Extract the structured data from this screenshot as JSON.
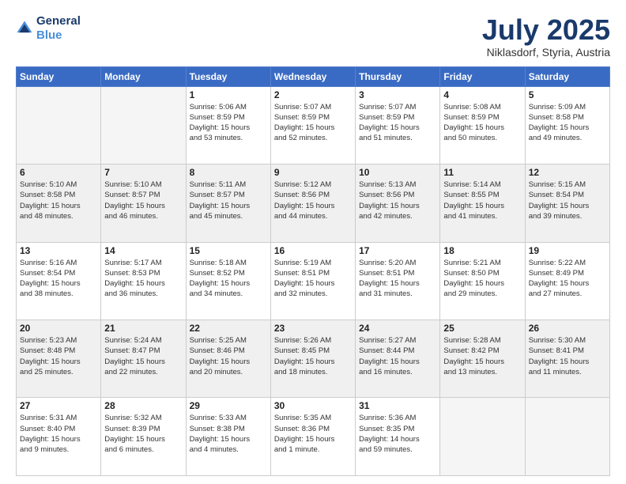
{
  "header": {
    "logo_line1": "General",
    "logo_line2": "Blue",
    "month": "July 2025",
    "location": "Niklasdorf, Styria, Austria"
  },
  "weekdays": [
    "Sunday",
    "Monday",
    "Tuesday",
    "Wednesday",
    "Thursday",
    "Friday",
    "Saturday"
  ],
  "weeks": [
    {
      "shaded": false,
      "days": [
        {
          "num": "",
          "lines": []
        },
        {
          "num": "",
          "lines": []
        },
        {
          "num": "1",
          "lines": [
            "Sunrise: 5:06 AM",
            "Sunset: 8:59 PM",
            "Daylight: 15 hours",
            "and 53 minutes."
          ]
        },
        {
          "num": "2",
          "lines": [
            "Sunrise: 5:07 AM",
            "Sunset: 8:59 PM",
            "Daylight: 15 hours",
            "and 52 minutes."
          ]
        },
        {
          "num": "3",
          "lines": [
            "Sunrise: 5:07 AM",
            "Sunset: 8:59 PM",
            "Daylight: 15 hours",
            "and 51 minutes."
          ]
        },
        {
          "num": "4",
          "lines": [
            "Sunrise: 5:08 AM",
            "Sunset: 8:59 PM",
            "Daylight: 15 hours",
            "and 50 minutes."
          ]
        },
        {
          "num": "5",
          "lines": [
            "Sunrise: 5:09 AM",
            "Sunset: 8:58 PM",
            "Daylight: 15 hours",
            "and 49 minutes."
          ]
        }
      ]
    },
    {
      "shaded": true,
      "days": [
        {
          "num": "6",
          "lines": [
            "Sunrise: 5:10 AM",
            "Sunset: 8:58 PM",
            "Daylight: 15 hours",
            "and 48 minutes."
          ]
        },
        {
          "num": "7",
          "lines": [
            "Sunrise: 5:10 AM",
            "Sunset: 8:57 PM",
            "Daylight: 15 hours",
            "and 46 minutes."
          ]
        },
        {
          "num": "8",
          "lines": [
            "Sunrise: 5:11 AM",
            "Sunset: 8:57 PM",
            "Daylight: 15 hours",
            "and 45 minutes."
          ]
        },
        {
          "num": "9",
          "lines": [
            "Sunrise: 5:12 AM",
            "Sunset: 8:56 PM",
            "Daylight: 15 hours",
            "and 44 minutes."
          ]
        },
        {
          "num": "10",
          "lines": [
            "Sunrise: 5:13 AM",
            "Sunset: 8:56 PM",
            "Daylight: 15 hours",
            "and 42 minutes."
          ]
        },
        {
          "num": "11",
          "lines": [
            "Sunrise: 5:14 AM",
            "Sunset: 8:55 PM",
            "Daylight: 15 hours",
            "and 41 minutes."
          ]
        },
        {
          "num": "12",
          "lines": [
            "Sunrise: 5:15 AM",
            "Sunset: 8:54 PM",
            "Daylight: 15 hours",
            "and 39 minutes."
          ]
        }
      ]
    },
    {
      "shaded": false,
      "days": [
        {
          "num": "13",
          "lines": [
            "Sunrise: 5:16 AM",
            "Sunset: 8:54 PM",
            "Daylight: 15 hours",
            "and 38 minutes."
          ]
        },
        {
          "num": "14",
          "lines": [
            "Sunrise: 5:17 AM",
            "Sunset: 8:53 PM",
            "Daylight: 15 hours",
            "and 36 minutes."
          ]
        },
        {
          "num": "15",
          "lines": [
            "Sunrise: 5:18 AM",
            "Sunset: 8:52 PM",
            "Daylight: 15 hours",
            "and 34 minutes."
          ]
        },
        {
          "num": "16",
          "lines": [
            "Sunrise: 5:19 AM",
            "Sunset: 8:51 PM",
            "Daylight: 15 hours",
            "and 32 minutes."
          ]
        },
        {
          "num": "17",
          "lines": [
            "Sunrise: 5:20 AM",
            "Sunset: 8:51 PM",
            "Daylight: 15 hours",
            "and 31 minutes."
          ]
        },
        {
          "num": "18",
          "lines": [
            "Sunrise: 5:21 AM",
            "Sunset: 8:50 PM",
            "Daylight: 15 hours",
            "and 29 minutes."
          ]
        },
        {
          "num": "19",
          "lines": [
            "Sunrise: 5:22 AM",
            "Sunset: 8:49 PM",
            "Daylight: 15 hours",
            "and 27 minutes."
          ]
        }
      ]
    },
    {
      "shaded": true,
      "days": [
        {
          "num": "20",
          "lines": [
            "Sunrise: 5:23 AM",
            "Sunset: 8:48 PM",
            "Daylight: 15 hours",
            "and 25 minutes."
          ]
        },
        {
          "num": "21",
          "lines": [
            "Sunrise: 5:24 AM",
            "Sunset: 8:47 PM",
            "Daylight: 15 hours",
            "and 22 minutes."
          ]
        },
        {
          "num": "22",
          "lines": [
            "Sunrise: 5:25 AM",
            "Sunset: 8:46 PM",
            "Daylight: 15 hours",
            "and 20 minutes."
          ]
        },
        {
          "num": "23",
          "lines": [
            "Sunrise: 5:26 AM",
            "Sunset: 8:45 PM",
            "Daylight: 15 hours",
            "and 18 minutes."
          ]
        },
        {
          "num": "24",
          "lines": [
            "Sunrise: 5:27 AM",
            "Sunset: 8:44 PM",
            "Daylight: 15 hours",
            "and 16 minutes."
          ]
        },
        {
          "num": "25",
          "lines": [
            "Sunrise: 5:28 AM",
            "Sunset: 8:42 PM",
            "Daylight: 15 hours",
            "and 13 minutes."
          ]
        },
        {
          "num": "26",
          "lines": [
            "Sunrise: 5:30 AM",
            "Sunset: 8:41 PM",
            "Daylight: 15 hours",
            "and 11 minutes."
          ]
        }
      ]
    },
    {
      "shaded": false,
      "days": [
        {
          "num": "27",
          "lines": [
            "Sunrise: 5:31 AM",
            "Sunset: 8:40 PM",
            "Daylight: 15 hours",
            "and 9 minutes."
          ]
        },
        {
          "num": "28",
          "lines": [
            "Sunrise: 5:32 AM",
            "Sunset: 8:39 PM",
            "Daylight: 15 hours",
            "and 6 minutes."
          ]
        },
        {
          "num": "29",
          "lines": [
            "Sunrise: 5:33 AM",
            "Sunset: 8:38 PM",
            "Daylight: 15 hours",
            "and 4 minutes."
          ]
        },
        {
          "num": "30",
          "lines": [
            "Sunrise: 5:35 AM",
            "Sunset: 8:36 PM",
            "Daylight: 15 hours",
            "and 1 minute."
          ]
        },
        {
          "num": "31",
          "lines": [
            "Sunrise: 5:36 AM",
            "Sunset: 8:35 PM",
            "Daylight: 14 hours",
            "and 59 minutes."
          ]
        },
        {
          "num": "",
          "lines": []
        },
        {
          "num": "",
          "lines": []
        }
      ]
    }
  ]
}
